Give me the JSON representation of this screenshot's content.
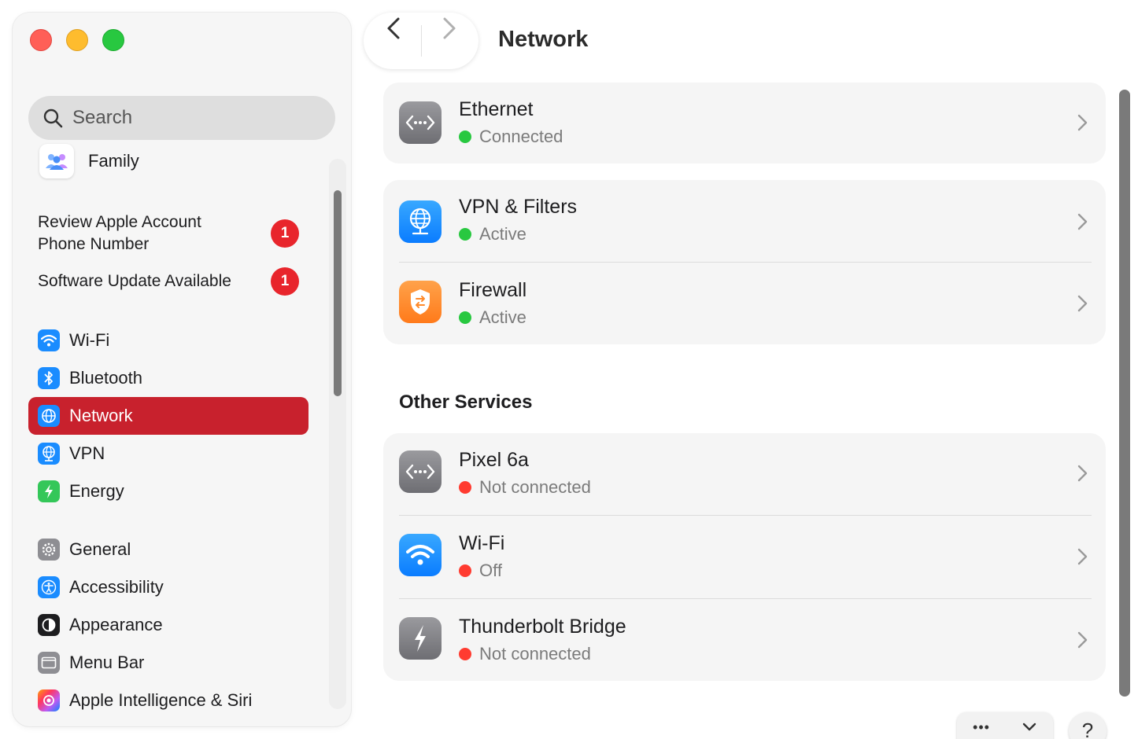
{
  "window": {
    "title": "Network"
  },
  "sidebar": {
    "search_placeholder": "Search",
    "family_label": "Family",
    "notices": [
      {
        "label_line1": "Review Apple Account",
        "label_line2": "Phone Number",
        "badge": "1"
      },
      {
        "label": "Software Update Available",
        "badge": "1"
      }
    ],
    "items": [
      {
        "label": "Wi-Fi",
        "icon": "wifi-icon",
        "color": "#1a8cff"
      },
      {
        "label": "Bluetooth",
        "icon": "bluetooth-icon",
        "color": "#1a8cff"
      },
      {
        "label": "Network",
        "icon": "globe-icon",
        "color": "#1a8cff",
        "selected": true
      },
      {
        "label": "VPN",
        "icon": "vpn-globe-icon",
        "color": "#1a8cff"
      },
      {
        "label": "Energy",
        "icon": "energy-bolt-icon",
        "color": "#34c759"
      },
      {
        "label": "General",
        "icon": "gear-icon",
        "color": "#8e8e93"
      },
      {
        "label": "Accessibility",
        "icon": "accessibility-icon",
        "color": "#1a8cff"
      },
      {
        "label": "Appearance",
        "icon": "appearance-icon",
        "color": "#1d1d1f"
      },
      {
        "label": "Menu Bar",
        "icon": "menu-bar-icon",
        "color": "#8e8e93"
      },
      {
        "label": "Apple Intelligence & Siri",
        "icon": "siri-icon",
        "color": "#ff6a3d"
      }
    ],
    "selected_color": "#c8212d"
  },
  "main": {
    "title": "Network",
    "services": [
      {
        "name": "Ethernet",
        "status": "Connected",
        "status_color": "#28c840",
        "icon": "ethernet-icon"
      },
      {
        "name": "VPN & Filters",
        "status": "Active",
        "status_color": "#28c840",
        "icon": "vpn-filters-icon"
      },
      {
        "name": "Firewall",
        "status": "Active",
        "status_color": "#28c840",
        "icon": "firewall-icon"
      }
    ],
    "other_services_title": "Other Services",
    "other_services": [
      {
        "name": "Pixel 6a",
        "status": "Not connected",
        "status_color": "#ff3b30",
        "icon": "ethernet-icon"
      },
      {
        "name": "Wi-Fi",
        "status": "Off",
        "status_color": "#ff3b30",
        "icon": "wifi-icon"
      },
      {
        "name": "Thunderbolt Bridge",
        "status": "Not connected",
        "status_color": "#ff3b30",
        "icon": "thunderbolt-icon"
      }
    ],
    "bottom": {
      "more_label": "•••",
      "help_label": "?"
    }
  }
}
